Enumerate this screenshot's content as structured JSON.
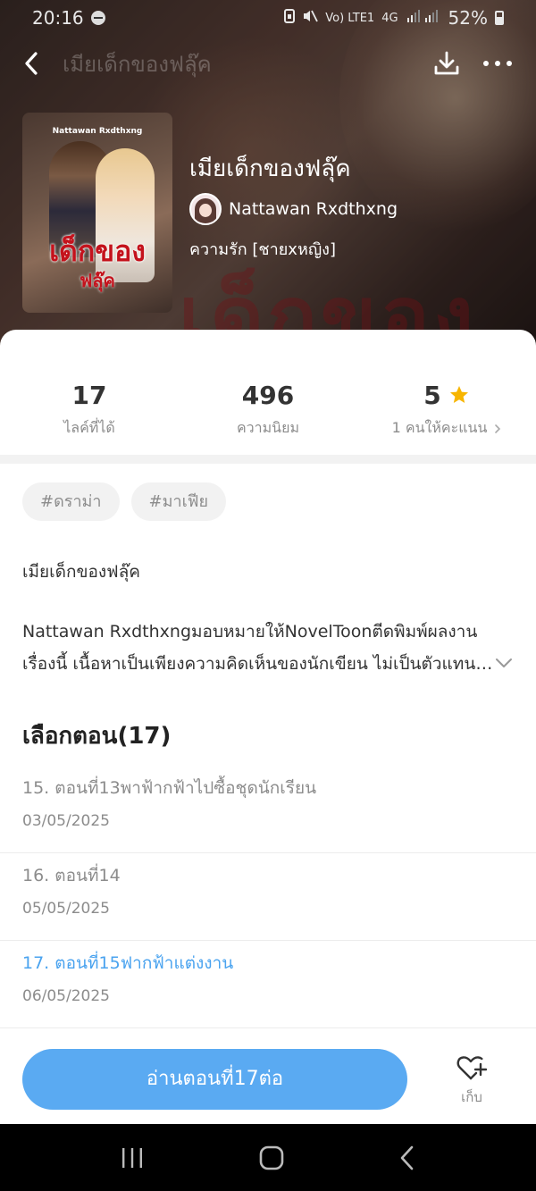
{
  "status_bar": {
    "time": "20:16",
    "network": "Vo) LTE1",
    "network_type": "4G",
    "battery": "52%"
  },
  "nav": {
    "title": "เมียเด็กของฟลุ๊ค",
    "back_icon": "chevron-left-icon",
    "download_icon": "download-icon",
    "more_icon": "more-icon"
  },
  "book": {
    "title": "เมียเด็กของฟลุ๊ค",
    "author": "Nattawan Rxdthxng",
    "genre": "ความรัก [ชายxหญิง]",
    "cover": {
      "author_text": "Nattawan Rxdthxng",
      "title_line1": "เด็กของ",
      "title_line2": "ฟลุ๊ค"
    }
  },
  "stats": {
    "likes": {
      "value": "17",
      "label": "ไลค์ที่ได้"
    },
    "popularity": {
      "value": "496",
      "label": "ความนิยม"
    },
    "rating": {
      "value": "5",
      "label": "1 คนให้คะแนน",
      "star_color": "#f7b500"
    }
  },
  "tags": [
    "#ดราม่า",
    "#มาเฟีย"
  ],
  "description": {
    "title": "เมียเด็กของฟลุ๊ค",
    "text": "Nattawan Rxdthxngมอบหมายให้NovelToonตีดพิมพ์ผลงานเรื่องนี้ เนื้อหาเป็นเพียงความคิดเห็นของนักเขียน ไม่เป็นตัวแทนของแพลตฟอร์ม"
  },
  "chapters": {
    "heading": "เลือกตอน(17)",
    "items": [
      {
        "title": "15. ตอนที่13พาฟ้ากฟ้าไปซื้อชุดนักเรียน",
        "date": "03/05/2025",
        "current": false
      },
      {
        "title": "16. ตอนที่14",
        "date": "05/05/2025",
        "current": false
      },
      {
        "title": "17. ตอนที่15ฟากฟ้าแต่งงาน",
        "date": "06/05/2025",
        "current": true
      }
    ]
  },
  "actions": {
    "read_button": "อ่านตอนที่17ต่อ",
    "collect_label": "เก็บ"
  },
  "colors": {
    "accent": "#5aaaf2",
    "current_chapter": "#4aa3ef",
    "star": "#f7b500"
  }
}
